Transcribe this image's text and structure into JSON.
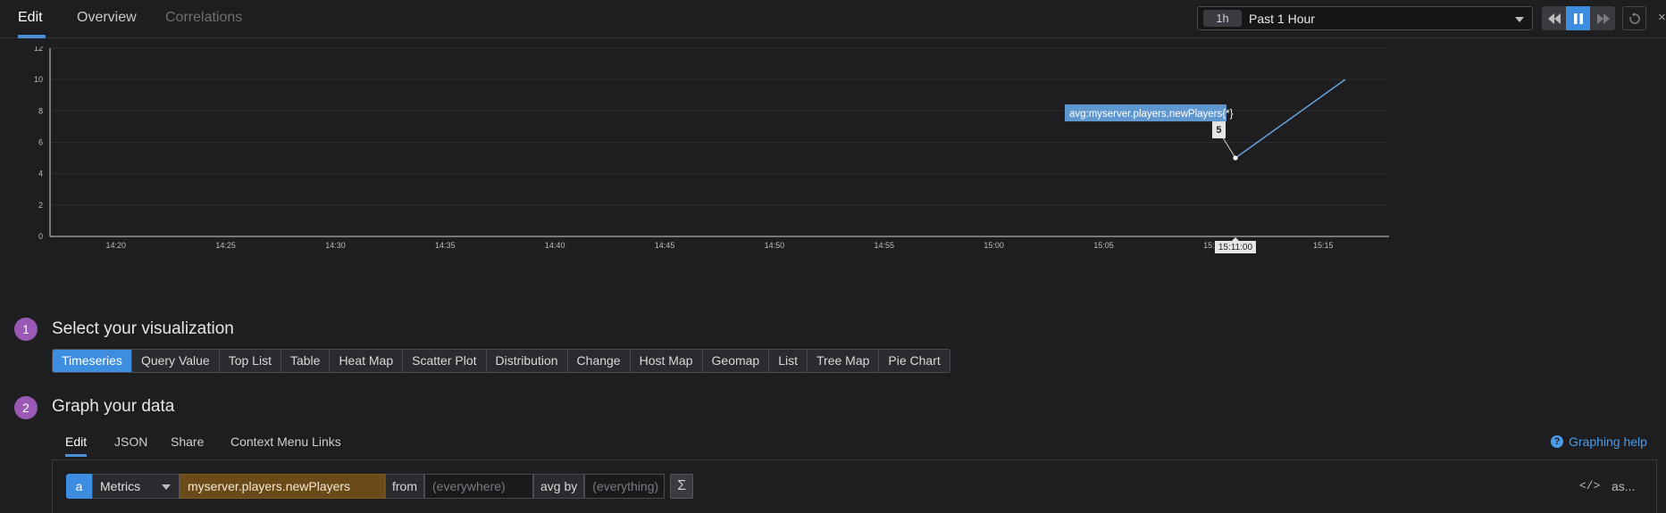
{
  "tabs": [
    {
      "label": "Edit"
    },
    {
      "label": "Overview"
    },
    {
      "label": "Correlations"
    }
  ],
  "timeframe": {
    "short": "1h",
    "label": "Past 1 Hour"
  },
  "controls": {
    "rewind_icon": "rewind-icon",
    "pause_icon": "pause-icon",
    "forward_icon": "fast-forward-icon",
    "reset_icon": "reset-icon"
  },
  "chart_data": {
    "type": "line",
    "ylim": [
      0,
      12
    ],
    "yticks": [
      "0",
      "2",
      "4",
      "6",
      "8",
      "10",
      "12"
    ],
    "xticks": [
      "14:20",
      "14:25",
      "14:30",
      "14:35",
      "14:40",
      "14:45",
      "14:50",
      "14:55",
      "15:00",
      "15:05",
      "15:10",
      "15:15"
    ],
    "x_range": [
      "14:17",
      "15:18"
    ],
    "series": [
      {
        "name": "avg:myserver.players.newPlayers{*}",
        "color": "#6aa3d9",
        "points": [
          {
            "x": "15:11",
            "y": 5
          },
          {
            "x": "15:16",
            "y": 10
          }
        ]
      }
    ],
    "tooltip": {
      "series": "avg:myserver.players.newPlayers{*}",
      "value": "5",
      "time": "15:11:00"
    },
    "grid": true
  },
  "step1": {
    "number": "1",
    "title": "Select your visualization"
  },
  "visualizations": [
    {
      "label": "Timeseries",
      "active": true
    },
    {
      "label": "Query Value"
    },
    {
      "label": "Top List"
    },
    {
      "label": "Table"
    },
    {
      "label": "Heat Map"
    },
    {
      "label": "Scatter Plot"
    },
    {
      "label": "Distribution"
    },
    {
      "label": "Change"
    },
    {
      "label": "Host Map"
    },
    {
      "label": "Geomap"
    },
    {
      "label": "List"
    },
    {
      "label": "Tree Map"
    },
    {
      "label": "Pie Chart"
    }
  ],
  "step2": {
    "number": "2",
    "title": "Graph your data"
  },
  "subtabs": [
    {
      "label": "Edit"
    },
    {
      "label": "JSON"
    },
    {
      "label": "Share"
    },
    {
      "label": "Context Menu Links"
    }
  ],
  "help": {
    "label": "Graphing help"
  },
  "query": {
    "letter": "a",
    "source": "Metrics",
    "metric": "myserver.players.newPlayers",
    "from_label": "from",
    "from_placeholder": "(everywhere)",
    "avgby_label": "avg by",
    "avgby_placeholder": "(everything)",
    "sum_symbol": "Σ",
    "code_symbol": "</>",
    "as_label": "as..."
  }
}
